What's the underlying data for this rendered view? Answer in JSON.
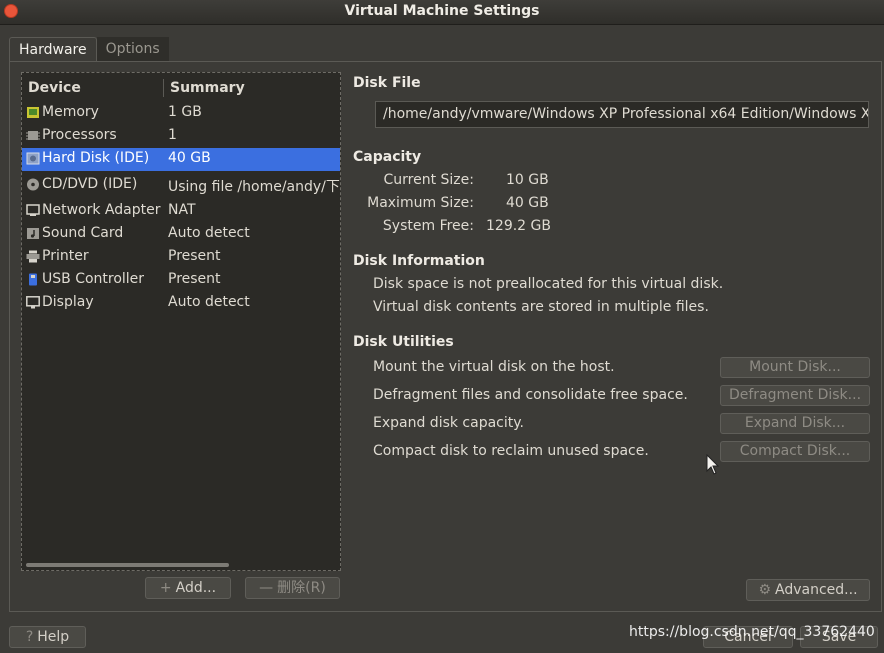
{
  "window": {
    "title": "Virtual Machine Settings"
  },
  "tabs": [
    {
      "label": "Hardware",
      "active": true
    },
    {
      "label": "Options",
      "active": false
    }
  ],
  "device_list": {
    "columns": [
      "Device",
      "Summary"
    ],
    "rows": [
      {
        "name": "Memory",
        "summary": "1 GB",
        "icon": "memory-icon"
      },
      {
        "name": "Processors",
        "summary": "1",
        "icon": "processor-icon"
      },
      {
        "name": "Hard Disk (IDE)",
        "summary": "40 GB",
        "icon": "hard-disk-icon",
        "selected": true
      },
      {
        "name": "CD/DVD (IDE)",
        "summary": "Using file /home/andy/下载",
        "icon": "cd-dvd-icon"
      },
      {
        "name": "Network Adapter",
        "summary": "NAT",
        "icon": "network-adapter-icon"
      },
      {
        "name": "Sound Card",
        "summary": "Auto detect",
        "icon": "sound-card-icon"
      },
      {
        "name": "Printer",
        "summary": "Present",
        "icon": "printer-icon"
      },
      {
        "name": "USB Controller",
        "summary": "Present",
        "icon": "usb-icon"
      },
      {
        "name": "Display",
        "summary": "Auto detect",
        "icon": "display-icon"
      }
    ]
  },
  "list_buttons": {
    "add": "Add...",
    "remove": "删除(R)"
  },
  "disk_file": {
    "title": "Disk File",
    "path": "/home/andy/vmware/Windows XP Professional x64 Edition/Windows X"
  },
  "capacity": {
    "title": "Capacity",
    "current_label": "Current Size:",
    "current_value": "10 GB",
    "max_label": "Maximum Size:",
    "max_value": "40 GB",
    "free_label": "System Free:",
    "free_value": "129.2 GB"
  },
  "disk_info": {
    "title": "Disk Information",
    "line1": "Disk space is not preallocated for this virtual disk.",
    "line2": "Virtual disk contents are stored in multiple files."
  },
  "disk_utilities": {
    "title": "Disk Utilities",
    "items": [
      {
        "text": "Mount the virtual disk on the host.",
        "button": "Mount Disk..."
      },
      {
        "text": "Defragment files and consolidate free space.",
        "button": "Defragment Disk..."
      },
      {
        "text": "Expand disk capacity.",
        "button": "Expand Disk..."
      },
      {
        "text": "Compact disk to reclaim unused space.",
        "button": "Compact Disk..."
      }
    ]
  },
  "advanced_button": "Advanced...",
  "footer": {
    "help": "Help",
    "cancel": "Cancel",
    "save": "Save"
  },
  "watermark": "https://blog.csdn.net/qq_33762440"
}
